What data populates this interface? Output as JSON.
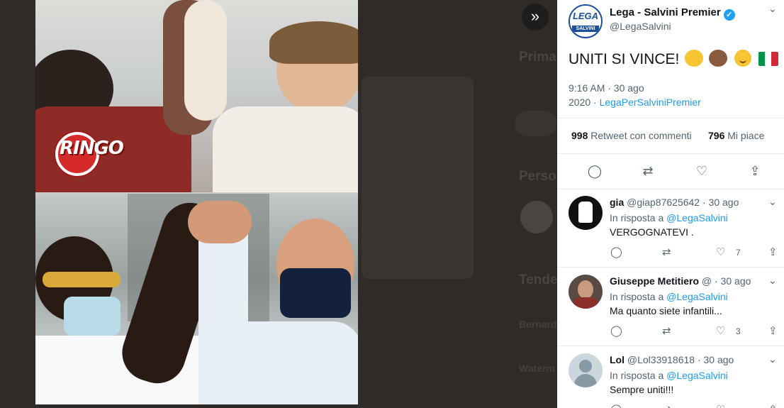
{
  "tweet": {
    "author_name": "Lega - Salvini Premier",
    "author_handle": "@LegaSalvini",
    "text": "UNITI SI VINCE!",
    "time": "9:16 AM · 30 ago",
    "date_year": "2020 ·",
    "source": "LegaPerSalviniPremier",
    "retweets_count": "998",
    "retweets_label": "Retweet con commenti",
    "likes_count": "796",
    "likes_label": "Mi piace"
  },
  "media": {
    "ringo_logo": "RINGO"
  },
  "background": {
    "heading_1": "Prima",
    "heading_2": "Perso",
    "heading_3": "Tende",
    "trend_1": "Bernard",
    "trend_2": "Waterm"
  },
  "replies": [
    {
      "name": "gia",
      "handle": "@giap87625642",
      "date": "· 30 ago",
      "reply_label": "In risposta a",
      "mention": "@LegaSalvini",
      "text": "VERGOGNATEVI .",
      "like_count": "7"
    },
    {
      "name": "Giuseppe Metitiero",
      "handle": "@",
      "date": "· 30 ago",
      "reply_label": "In risposta a",
      "mention": "@LegaSalvini",
      "text": "Ma quanto siete infantili...",
      "like_count": "3"
    },
    {
      "name": "Lol",
      "handle": "@Lol33918618",
      "date": "· 30 ago",
      "reply_label": "In risposta a",
      "mention": "@LegaSalvini",
      "text": "Sempre uniti!!!",
      "like_count": ""
    }
  ],
  "icons": {
    "nav": "double-chevron-right-icon",
    "reply": "speech-bubble-icon",
    "retweet": "retweet-icon",
    "like": "heart-icon",
    "share": "share-icon"
  },
  "colors": {
    "link": "#1d9bf0",
    "verified": "#1da1f2",
    "lega_blue": "#1b4f9c",
    "ringo_red": "#d42a2a"
  }
}
